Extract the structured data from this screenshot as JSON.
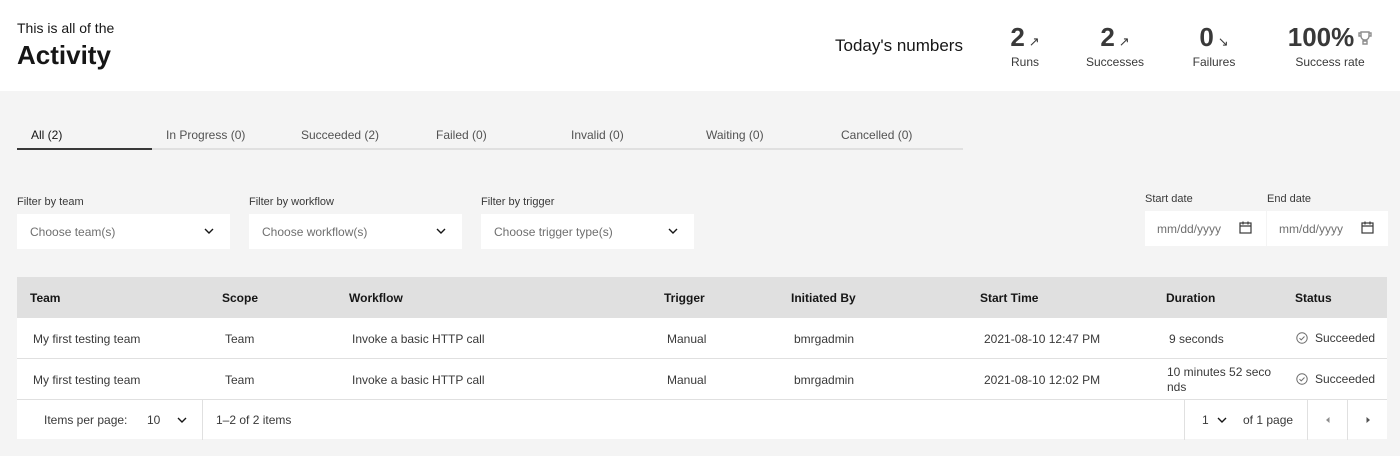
{
  "header": {
    "subtitle": "This is all of the",
    "title": "Activity",
    "numbers_label": "Today's numbers",
    "stats": [
      {
        "value": "2",
        "label": "Runs",
        "indicator": "arrow-up-right-icon"
      },
      {
        "value": "2",
        "label": "Successes",
        "indicator": "arrow-up-right-icon"
      },
      {
        "value": "0",
        "label": "Failures",
        "indicator": "arrow-down-right-icon"
      },
      {
        "value": "100%",
        "label": "Success rate",
        "indicator": "trophy-icon"
      }
    ]
  },
  "tabs": [
    {
      "label": "All (2)",
      "active": true
    },
    {
      "label": "In Progress (0)"
    },
    {
      "label": "Succeeded (2)"
    },
    {
      "label": "Failed (0)"
    },
    {
      "label": "Invalid (0)"
    },
    {
      "label": "Waiting (0)"
    },
    {
      "label": "Cancelled (0)"
    }
  ],
  "filters": {
    "team": {
      "label": "Filter by team",
      "placeholder": "Choose team(s)"
    },
    "workflow": {
      "label": "Filter by workflow",
      "placeholder": "Choose workflow(s)"
    },
    "trigger": {
      "label": "Filter by trigger",
      "placeholder": "Choose trigger type(s)"
    },
    "start_date": {
      "label": "Start date",
      "placeholder": "mm/dd/yyyy"
    },
    "end_date": {
      "label": "End date",
      "placeholder": "mm/dd/yyyy"
    }
  },
  "table": {
    "columns": [
      "Team",
      "Scope",
      "Workflow",
      "Trigger",
      "Initiated By",
      "Start Time",
      "Duration",
      "Status"
    ],
    "rows": [
      {
        "team": "My first testing team",
        "scope": "Team",
        "workflow": "Invoke a basic HTTP call",
        "trigger": "Manual",
        "initiated_by": "bmrgadmin",
        "start_time": "2021-08-10 12:47 PM",
        "duration": "9 seconds",
        "status": "Succeeded"
      },
      {
        "team": "My first testing team",
        "scope": "Team",
        "workflow": "Invoke a basic HTTP call",
        "trigger": "Manual",
        "initiated_by": "bmrgadmin",
        "start_time": "2021-08-10 12:02 PM",
        "duration": "10 minutes 52 seconds",
        "status": "Succeeded"
      }
    ]
  },
  "pagination": {
    "items_per_page_label": "Items per page:",
    "items_per_page": "10",
    "range": "1–2 of 2 items",
    "page": "1",
    "of_pages": "of 1 page"
  },
  "colors": {
    "success": "#6f6f6f",
    "header_bg": "#ffffff",
    "page_bg": "#f4f4f4",
    "table_header_bg": "#e0e0e0"
  }
}
